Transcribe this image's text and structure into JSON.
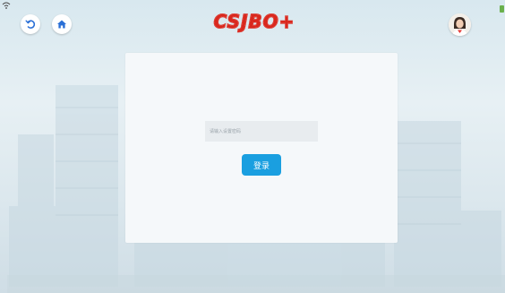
{
  "header": {
    "logo_text": "CSJBO+",
    "back_icon": "back-arrow-icon",
    "home_icon": "home-icon",
    "avatar_icon": "user-avatar",
    "status_icons": [
      "wifi-icon",
      "battery-icon"
    ]
  },
  "login": {
    "password_placeholder": "请输入设置密码",
    "password_value": "",
    "submit_label": "登录"
  },
  "colors": {
    "accent": "#1a9fe0",
    "logo": "#d9281e",
    "icon_blue": "#2a6fd6",
    "card": "#f5f8fa",
    "input_bg": "#e8ecef"
  }
}
